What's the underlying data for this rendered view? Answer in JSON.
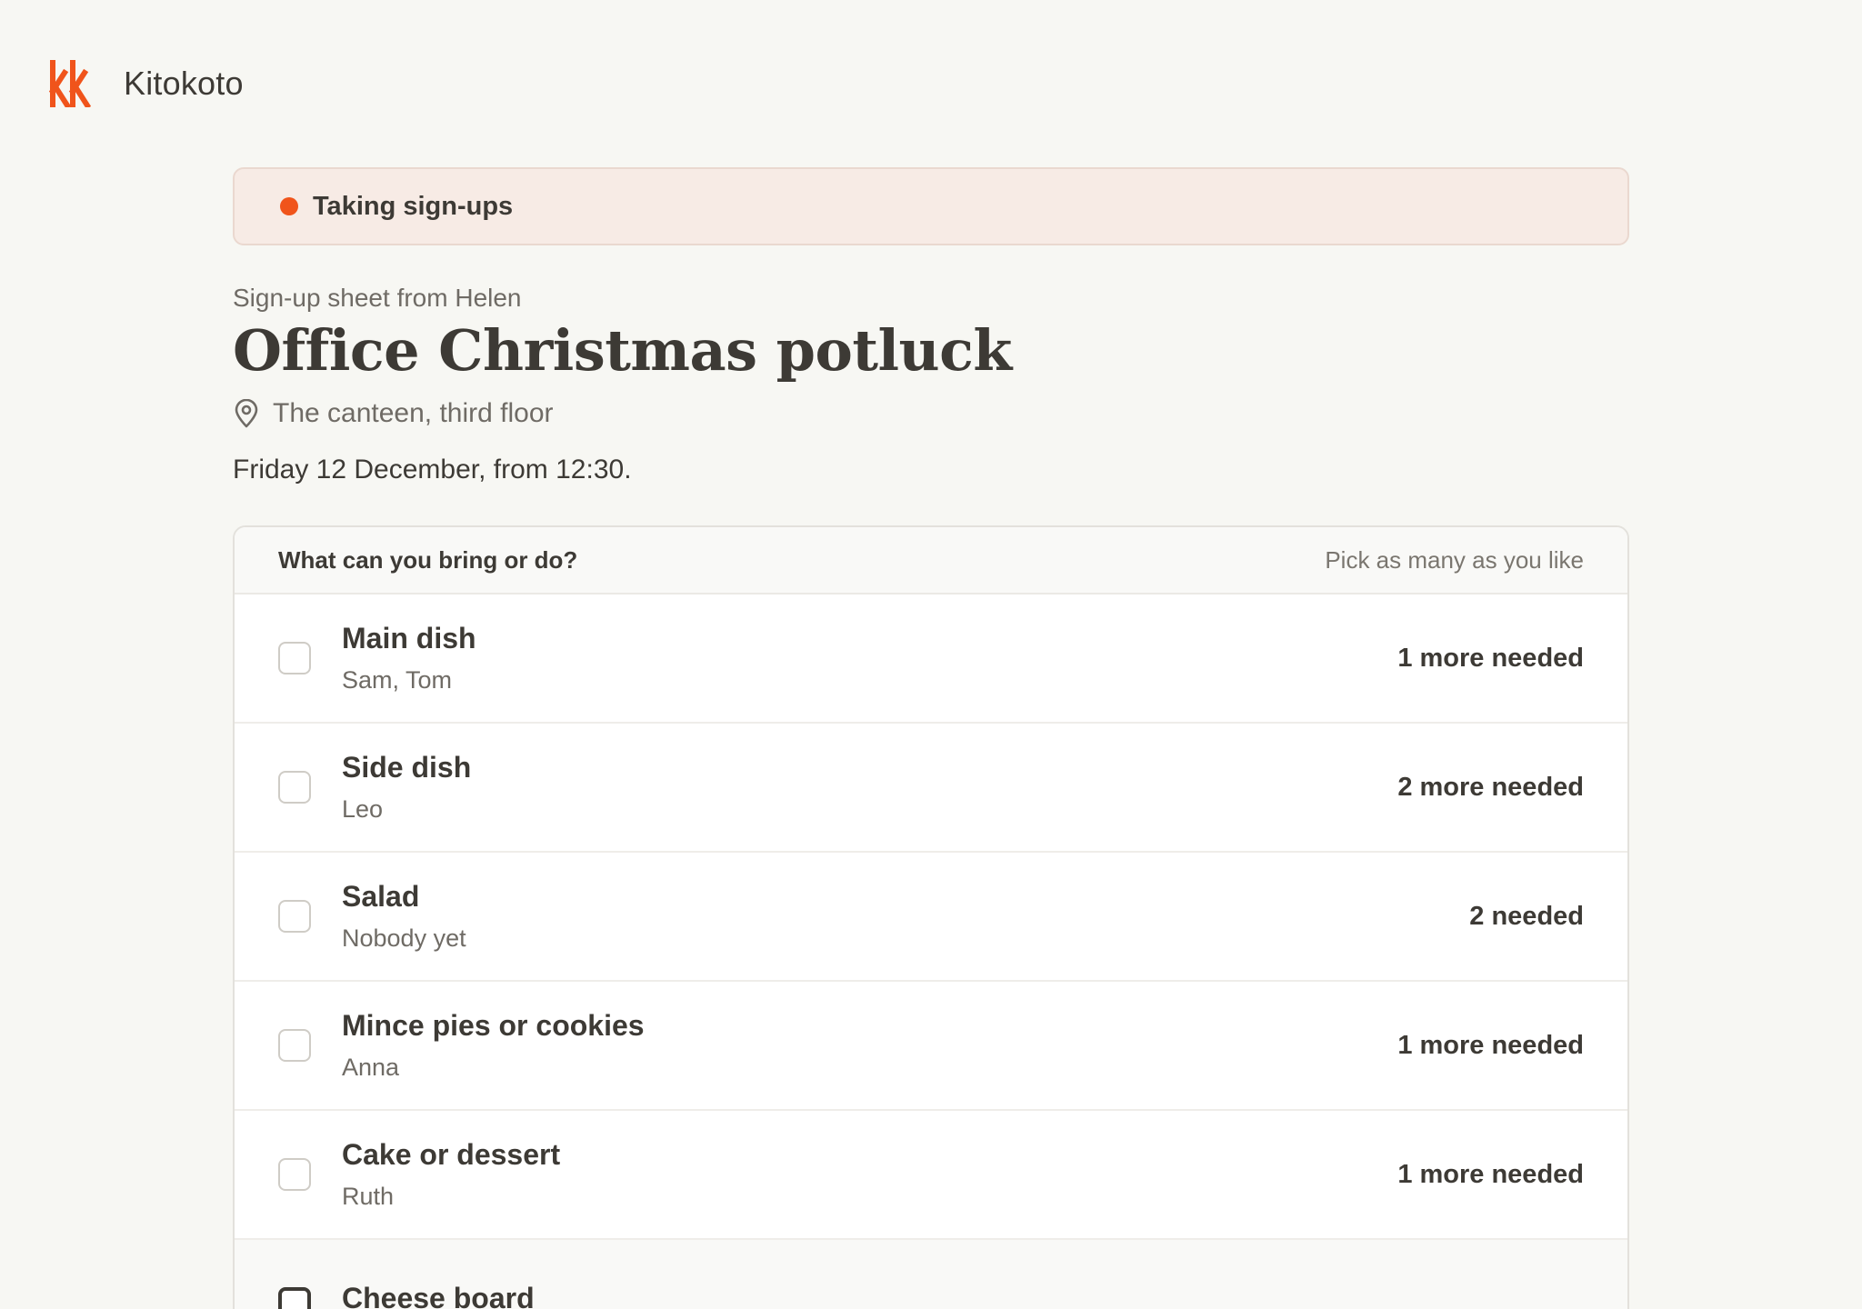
{
  "brand": {
    "name": "Kitokoto",
    "logo_icon": "kk-logo",
    "logo_color": "#f0541b"
  },
  "status": {
    "label": "Taking sign-ups",
    "dot_color": "#f0541b"
  },
  "sheet": {
    "from": "Sign-up sheet from Helen",
    "title": "Office Christmas potluck",
    "location_icon": "map-pin-icon",
    "location": "The canteen, third floor",
    "date": "Friday 12 December, from 12:30."
  },
  "list": {
    "question": "What can you bring or do?",
    "hint": "Pick as many as you like",
    "items": [
      {
        "title": "Main dish",
        "people": "Sam, Tom",
        "need": "1 more needed"
      },
      {
        "title": "Side dish",
        "people": "Leo",
        "need": "2 more needed"
      },
      {
        "title": "Salad",
        "people": "Nobody yet",
        "need": "2 needed"
      },
      {
        "title": "Mince pies or cookies",
        "people": "Anna",
        "need": "1 more needed"
      },
      {
        "title": "Cake or dessert",
        "people": "Ruth",
        "need": "1 more needed"
      },
      {
        "title": "Cheese board",
        "people": "",
        "need": ""
      }
    ]
  }
}
